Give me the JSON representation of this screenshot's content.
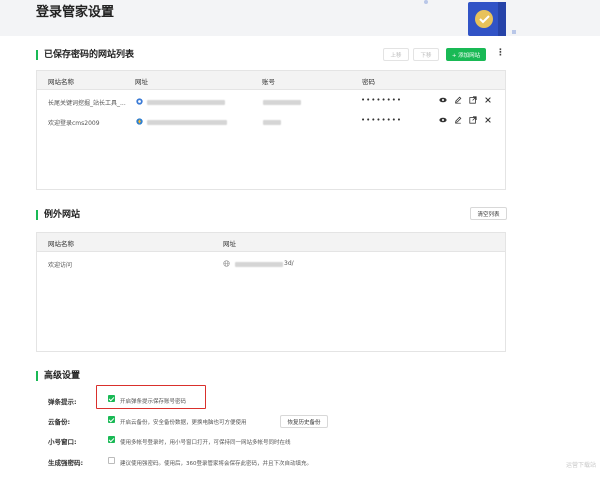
{
  "page_title": "登录管家设置",
  "saved_section": {
    "title": "已保存密码的网站列表",
    "btn_up": "上移",
    "btn_down": "下移",
    "btn_add": "+ 添加网站",
    "more": "⋮",
    "columns": [
      "网站名称",
      "网址",
      "账号",
      "密码"
    ],
    "rows": [
      {
        "name": "长尾关键词挖掘_站长工具_...",
        "password": "••••••••"
      },
      {
        "name": "欢迎登录cms2009",
        "password": "••••••••"
      }
    ]
  },
  "exception_section": {
    "title": "例外网站",
    "btn_clear": "清空列表",
    "columns": [
      "网站名称",
      "网址"
    ],
    "rows": [
      {
        "name": "欢迎访问",
        "url_tail": "3d/"
      }
    ]
  },
  "advanced_section": {
    "title": "高级设置",
    "settings": [
      {
        "label": "弹条提示:",
        "checked": true,
        "text": "开启弹条提示保存账号密码"
      },
      {
        "label": "云备份:",
        "checked": true,
        "text": "开启云备份，安全备份数据，更换电脑也可方便使用",
        "button": "恢复历史备份"
      },
      {
        "label": "小号窗口:",
        "checked": true,
        "text": "使用多帐号登录时，用小号窗口打开，可保持同一网站多帐号同时在线"
      },
      {
        "label": "生成强密码:",
        "checked": false,
        "text": "建议使用强密码。使用后，360登录管家将会保存此密码，并且下次自动填充。"
      }
    ]
  },
  "watermark": "运营下载站",
  "colors": {
    "accent": "#19b955",
    "highlight": "#d9302c"
  },
  "icons": [
    "lock-illustration",
    "eye-icon",
    "edit-icon",
    "open-link-icon",
    "close-icon",
    "globe-icon"
  ]
}
